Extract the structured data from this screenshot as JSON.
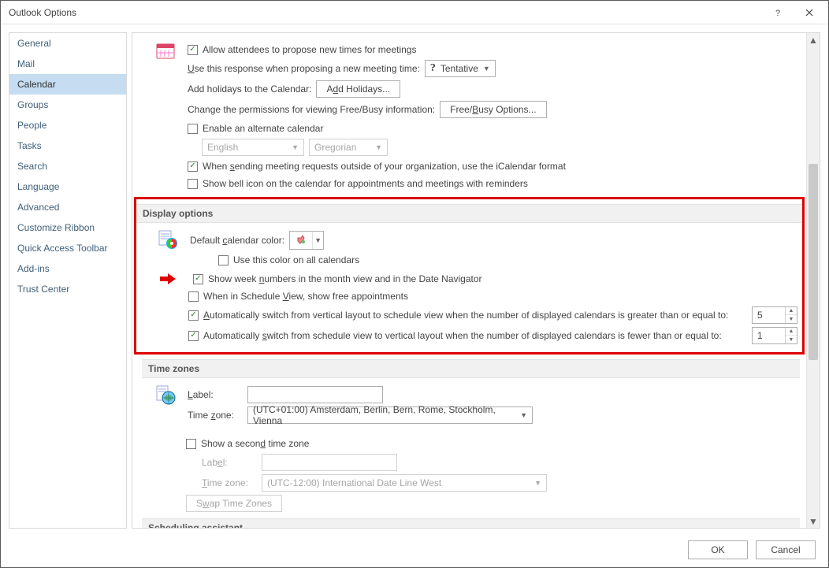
{
  "window": {
    "title": "Outlook Options"
  },
  "sidebar": {
    "items": [
      "General",
      "Mail",
      "Calendar",
      "Groups",
      "People",
      "Tasks",
      "Search",
      "Language",
      "Advanced",
      "Customize Ribbon",
      "Quick Access Toolbar",
      "Add-ins",
      "Trust Center"
    ],
    "active": "Calendar"
  },
  "top_options": {
    "allow_propose": "Allow attendees to propose new times for meetings",
    "response_label": "Use this response when proposing a new meeting time:",
    "response_value": "Tentative",
    "add_holidays_label": "Add holidays to the Calendar:",
    "add_holidays_btn": "Add Holidays...",
    "freebusy_label": "Change the permissions for viewing Free/Busy information:",
    "freebusy_btn": "Free/Busy Options...",
    "enable_alt_cal": "Enable an alternate calendar",
    "alt_lang": "English",
    "alt_type": "Gregorian",
    "icalendar": "When sending meeting requests outside of your organization, use the iCalendar format",
    "bell_icon": "Show bell icon on the calendar for appointments and meetings with reminders"
  },
  "display": {
    "header": "Display options",
    "default_color_label": "Default calendar color:",
    "use_color_all": "Use this color on all calendars",
    "show_week_numbers": "Show week numbers in the month view and in the Date Navigator",
    "schedule_free": "When in Schedule View, show free appointments",
    "auto_to_schedule": "Automatically switch from vertical layout to schedule view when the number of displayed calendars is greater than or equal to:",
    "auto_to_schedule_val": "5",
    "auto_to_vertical": "Automatically switch from schedule view to vertical layout when the number of displayed calendars is fewer than or equal to:",
    "auto_to_vertical_val": "1"
  },
  "timezones": {
    "header": "Time zones",
    "label": "Label:",
    "label_value": "",
    "tz_label": "Time zone:",
    "tz_value": "(UTC+01:00) Amsterdam, Berlin, Bern, Rome, Stockholm, Vienna",
    "show_second": "Show a second time zone",
    "label2": "Label:",
    "label2_value": "",
    "tz2_label": "Time zone:",
    "tz2_value": "(UTC-12:00) International Date Line West",
    "swap_btn": "Swap Time Zones"
  },
  "scheduling": {
    "header": "Scheduling assistant"
  },
  "footer": {
    "ok": "OK",
    "cancel": "Cancel"
  }
}
